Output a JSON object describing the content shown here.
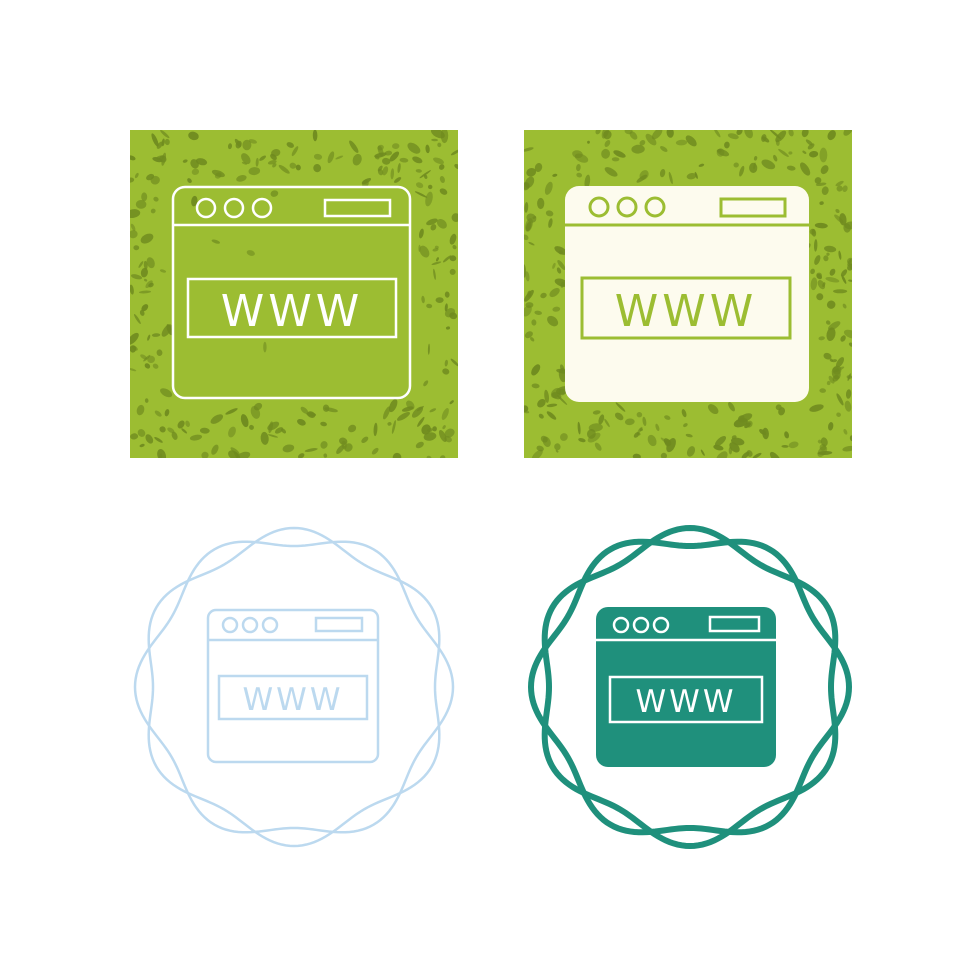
{
  "icons": [
    {
      "variant": "glyph-on-grunge-square",
      "address_text": "WWW",
      "colors": {
        "background": "#9cbd32",
        "texture": "#6f8a1f",
        "stroke": "#ffffff"
      }
    },
    {
      "variant": "filled-on-grunge-square",
      "address_text": "WWW",
      "colors": {
        "background": "#9cbd32",
        "texture": "#6f8a1f",
        "fill": "#fdfbee",
        "stroke": "#9cbd32"
      }
    },
    {
      "variant": "outline-in-badge",
      "address_text": "WWW",
      "colors": {
        "stroke": "#bcd9ef"
      }
    },
    {
      "variant": "filled-in-badge",
      "address_text": "WWW",
      "colors": {
        "badge": "#1f907c",
        "fill": "#1f907c",
        "stroke": "#ffffff"
      }
    }
  ]
}
